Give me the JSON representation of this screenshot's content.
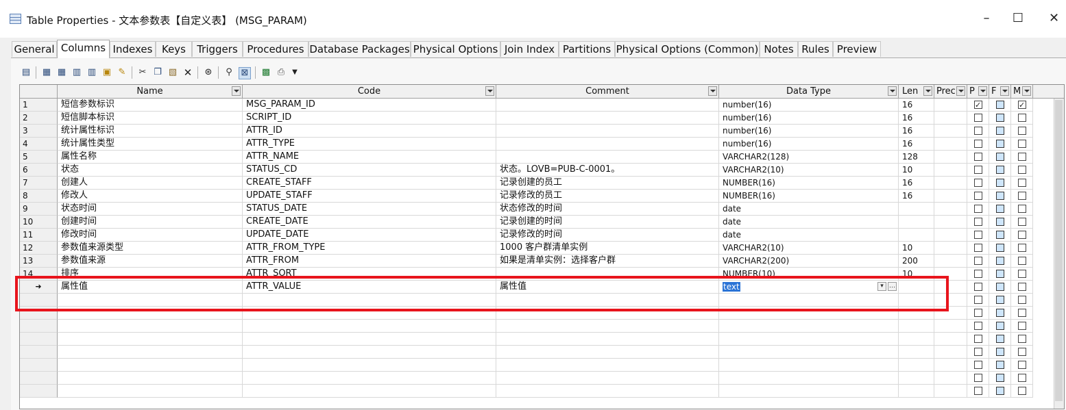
{
  "window": {
    "title": "Table Properties - 文本参数表【自定义表】 (MSG_PARAM)",
    "minimize_glyph": "–",
    "maximize_glyph": "☐",
    "close_glyph": "✕"
  },
  "tabs": [
    {
      "label": "General",
      "active": false
    },
    {
      "label": "Columns",
      "active": true
    },
    {
      "label": "Indexes",
      "active": false
    },
    {
      "label": "Keys",
      "active": false
    },
    {
      "label": "Triggers",
      "active": false
    },
    {
      "label": "Procedures",
      "active": false
    },
    {
      "label": "Database Packages",
      "active": false
    },
    {
      "label": "Physical Options",
      "active": false
    },
    {
      "label": "Join Index",
      "active": false
    },
    {
      "label": "Partitions",
      "active": false
    },
    {
      "label": "Physical Options (Common)",
      "active": false
    },
    {
      "label": "Notes",
      "active": false
    },
    {
      "label": "Rules",
      "active": false
    },
    {
      "label": "Preview",
      "active": false
    }
  ],
  "toolbar": {
    "buttons": [
      "properties-icon",
      "add-row-icon",
      "insert-row-icon",
      "add-columns-icon",
      "delete-row-icon",
      "clear-icon",
      "cut-icon",
      "copy-icon",
      "paste-icon",
      "delete-icon",
      "find-icon",
      "filter-icon",
      "customize-columns-icon",
      "excel-icon",
      "print-icon",
      "dropdown-arrow-icon"
    ]
  },
  "grid": {
    "columns": {
      "name": "Name",
      "code": "Code",
      "comment": "Comment",
      "data_type": "Data Type",
      "length": "Len",
      "precision": "Prec",
      "primary": "P",
      "foreign": "F",
      "mandatory": "M"
    },
    "rows": [
      {
        "num": "1",
        "name": "短信参数标识",
        "code": "MSG_PARAM_ID",
        "comment": "",
        "data_type": "number(16)",
        "length": "16",
        "p": true,
        "m": true
      },
      {
        "num": "2",
        "name": "短信脚本标识",
        "code": "SCRIPT_ID",
        "comment": "",
        "data_type": "number(16)",
        "length": "16",
        "p": false,
        "m": false
      },
      {
        "num": "3",
        "name": "统计属性标识",
        "code": "ATTR_ID",
        "comment": "",
        "data_type": "number(16)",
        "length": "16",
        "p": false,
        "m": false
      },
      {
        "num": "4",
        "name": "统计属性类型",
        "code": "ATTR_TYPE",
        "comment": "",
        "data_type": "number(16)",
        "length": "16",
        "p": false,
        "m": false
      },
      {
        "num": "5",
        "name": "属性名称",
        "code": "ATTR_NAME",
        "comment": "",
        "data_type": "VARCHAR2(128)",
        "length": "128",
        "p": false,
        "m": false
      },
      {
        "num": "6",
        "name": "状态",
        "code": "STATUS_CD",
        "comment": "状态。LOVB=PUB-C-0001。",
        "data_type": "VARCHAR2(10)",
        "length": "10",
        "p": false,
        "m": false
      },
      {
        "num": "7",
        "name": "创建人",
        "code": "CREATE_STAFF",
        "comment": "记录创建的员工",
        "data_type": "NUMBER(16)",
        "length": "16",
        "p": false,
        "m": false
      },
      {
        "num": "8",
        "name": "修改人",
        "code": "UPDATE_STAFF",
        "comment": "记录修改的员工",
        "data_type": "NUMBER(16)",
        "length": "16",
        "p": false,
        "m": false
      },
      {
        "num": "9",
        "name": "状态时间",
        "code": "STATUS_DATE",
        "comment": "状态修改的时间",
        "data_type": "date",
        "length": "",
        "p": false,
        "m": false
      },
      {
        "num": "10",
        "name": "创建时间",
        "code": "CREATE_DATE",
        "comment": "记录创建的时间",
        "data_type": "date",
        "length": "",
        "p": false,
        "m": false
      },
      {
        "num": "11",
        "name": "修改时间",
        "code": "UPDATE_DATE",
        "comment": "记录修改的时间",
        "data_type": "date",
        "length": "",
        "p": false,
        "m": false
      },
      {
        "num": "12",
        "name": "参数值来源类型",
        "code": "ATTR_FROM_TYPE",
        "comment": "1000 客户群清单实例",
        "data_type": "VARCHAR2(10)",
        "length": "10",
        "p": false,
        "m": false
      },
      {
        "num": "13",
        "name": "参数值来源",
        "code": "ATTR_FROM",
        "comment": "如果是清单实例：选择客户群",
        "data_type": "VARCHAR2(200)",
        "length": "200",
        "p": false,
        "m": false
      },
      {
        "num": "14",
        "name": "排序",
        "code": "ATTR_SORT",
        "comment": "",
        "data_type": "NUMBER(10)",
        "length": "10",
        "p": false,
        "m": false
      },
      {
        "num": "➜",
        "name": "属性值",
        "code": "ATTR_VALUE",
        "comment": "属性值",
        "data_type": "text",
        "length": "",
        "p": false,
        "m": false,
        "editing": true
      }
    ],
    "empty_rows": 8,
    "combo_dropdown_glyph": "▾",
    "combo_ellipsis_glyph": "…"
  },
  "colors": {
    "highlight_border": "#e8141c",
    "selection": "#2a73d6",
    "foreign_key_checkbox": "#cfe6fb"
  }
}
